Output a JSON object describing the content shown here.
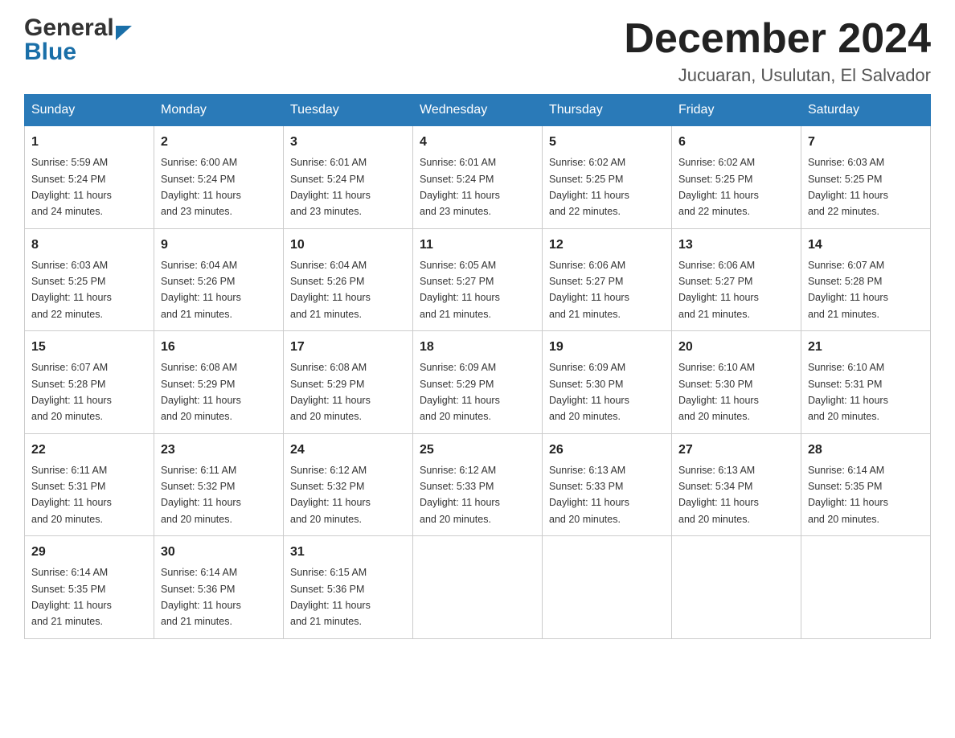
{
  "header": {
    "logo_general": "General",
    "logo_blue": "Blue",
    "title": "December 2024",
    "subtitle": "Jucuaran, Usulutan, El Salvador"
  },
  "days_of_week": [
    "Sunday",
    "Monday",
    "Tuesday",
    "Wednesday",
    "Thursday",
    "Friday",
    "Saturday"
  ],
  "weeks": [
    [
      {
        "day": "1",
        "sunrise": "5:59 AM",
        "sunset": "5:24 PM",
        "daylight": "11 hours and 24 minutes."
      },
      {
        "day": "2",
        "sunrise": "6:00 AM",
        "sunset": "5:24 PM",
        "daylight": "11 hours and 23 minutes."
      },
      {
        "day": "3",
        "sunrise": "6:01 AM",
        "sunset": "5:24 PM",
        "daylight": "11 hours and 23 minutes."
      },
      {
        "day": "4",
        "sunrise": "6:01 AM",
        "sunset": "5:24 PM",
        "daylight": "11 hours and 23 minutes."
      },
      {
        "day": "5",
        "sunrise": "6:02 AM",
        "sunset": "5:25 PM",
        "daylight": "11 hours and 22 minutes."
      },
      {
        "day": "6",
        "sunrise": "6:02 AM",
        "sunset": "5:25 PM",
        "daylight": "11 hours and 22 minutes."
      },
      {
        "day": "7",
        "sunrise": "6:03 AM",
        "sunset": "5:25 PM",
        "daylight": "11 hours and 22 minutes."
      }
    ],
    [
      {
        "day": "8",
        "sunrise": "6:03 AM",
        "sunset": "5:25 PM",
        "daylight": "11 hours and 22 minutes."
      },
      {
        "day": "9",
        "sunrise": "6:04 AM",
        "sunset": "5:26 PM",
        "daylight": "11 hours and 21 minutes."
      },
      {
        "day": "10",
        "sunrise": "6:04 AM",
        "sunset": "5:26 PM",
        "daylight": "11 hours and 21 minutes."
      },
      {
        "day": "11",
        "sunrise": "6:05 AM",
        "sunset": "5:27 PM",
        "daylight": "11 hours and 21 minutes."
      },
      {
        "day": "12",
        "sunrise": "6:06 AM",
        "sunset": "5:27 PM",
        "daylight": "11 hours and 21 minutes."
      },
      {
        "day": "13",
        "sunrise": "6:06 AM",
        "sunset": "5:27 PM",
        "daylight": "11 hours and 21 minutes."
      },
      {
        "day": "14",
        "sunrise": "6:07 AM",
        "sunset": "5:28 PM",
        "daylight": "11 hours and 21 minutes."
      }
    ],
    [
      {
        "day": "15",
        "sunrise": "6:07 AM",
        "sunset": "5:28 PM",
        "daylight": "11 hours and 20 minutes."
      },
      {
        "day": "16",
        "sunrise": "6:08 AM",
        "sunset": "5:29 PM",
        "daylight": "11 hours and 20 minutes."
      },
      {
        "day": "17",
        "sunrise": "6:08 AM",
        "sunset": "5:29 PM",
        "daylight": "11 hours and 20 minutes."
      },
      {
        "day": "18",
        "sunrise": "6:09 AM",
        "sunset": "5:29 PM",
        "daylight": "11 hours and 20 minutes."
      },
      {
        "day": "19",
        "sunrise": "6:09 AM",
        "sunset": "5:30 PM",
        "daylight": "11 hours and 20 minutes."
      },
      {
        "day": "20",
        "sunrise": "6:10 AM",
        "sunset": "5:30 PM",
        "daylight": "11 hours and 20 minutes."
      },
      {
        "day": "21",
        "sunrise": "6:10 AM",
        "sunset": "5:31 PM",
        "daylight": "11 hours and 20 minutes."
      }
    ],
    [
      {
        "day": "22",
        "sunrise": "6:11 AM",
        "sunset": "5:31 PM",
        "daylight": "11 hours and 20 minutes."
      },
      {
        "day": "23",
        "sunrise": "6:11 AM",
        "sunset": "5:32 PM",
        "daylight": "11 hours and 20 minutes."
      },
      {
        "day": "24",
        "sunrise": "6:12 AM",
        "sunset": "5:32 PM",
        "daylight": "11 hours and 20 minutes."
      },
      {
        "day": "25",
        "sunrise": "6:12 AM",
        "sunset": "5:33 PM",
        "daylight": "11 hours and 20 minutes."
      },
      {
        "day": "26",
        "sunrise": "6:13 AM",
        "sunset": "5:33 PM",
        "daylight": "11 hours and 20 minutes."
      },
      {
        "day": "27",
        "sunrise": "6:13 AM",
        "sunset": "5:34 PM",
        "daylight": "11 hours and 20 minutes."
      },
      {
        "day": "28",
        "sunrise": "6:14 AM",
        "sunset": "5:35 PM",
        "daylight": "11 hours and 20 minutes."
      }
    ],
    [
      {
        "day": "29",
        "sunrise": "6:14 AM",
        "sunset": "5:35 PM",
        "daylight": "11 hours and 21 minutes."
      },
      {
        "day": "30",
        "sunrise": "6:14 AM",
        "sunset": "5:36 PM",
        "daylight": "11 hours and 21 minutes."
      },
      {
        "day": "31",
        "sunrise": "6:15 AM",
        "sunset": "5:36 PM",
        "daylight": "11 hours and 21 minutes."
      },
      null,
      null,
      null,
      null
    ]
  ],
  "labels": {
    "sunrise": "Sunrise:",
    "sunset": "Sunset:",
    "daylight": "Daylight:"
  }
}
